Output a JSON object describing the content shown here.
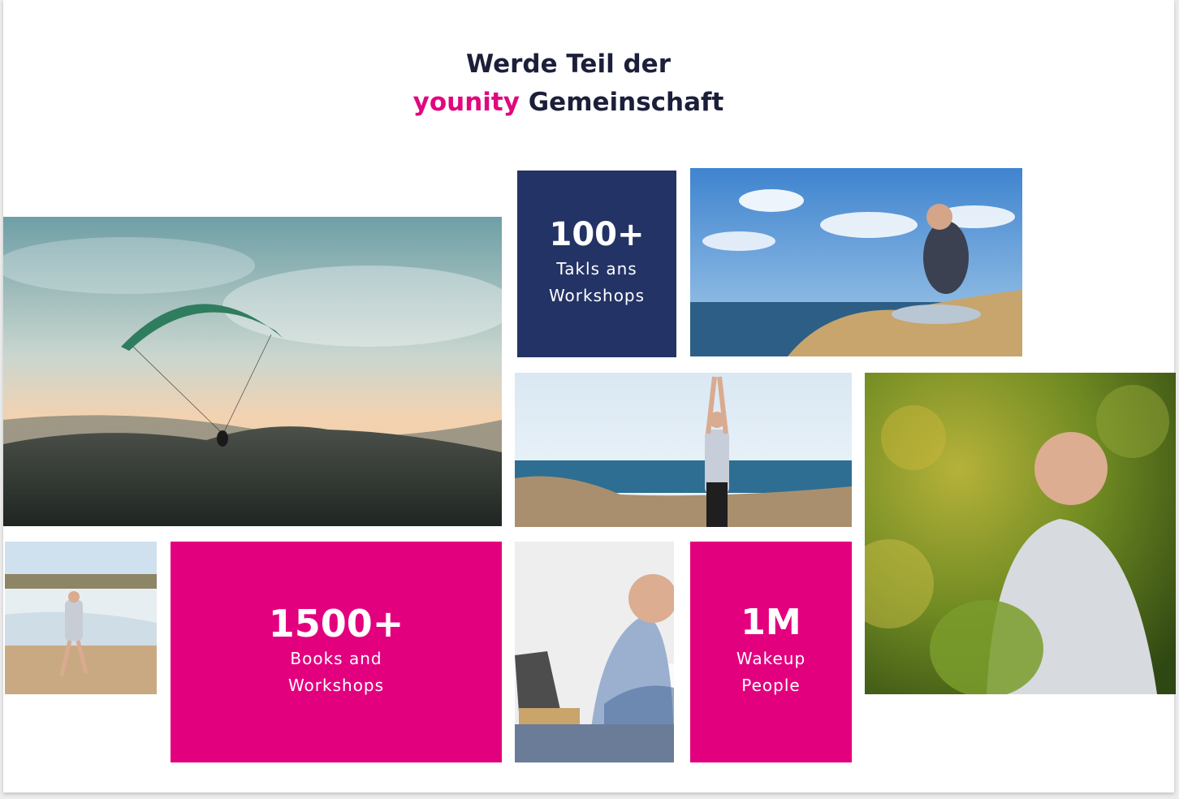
{
  "heading": {
    "line1": "Werde Teil der",
    "brand": "younity",
    "line2_rest": " Gemeinschaft"
  },
  "stats": [
    {
      "number": "100+",
      "label_line1": "Takls ans",
      "label_line2": "Workshops",
      "color": "#233365"
    },
    {
      "number": "1500+",
      "label_line1": "Books and",
      "label_line2": "Workshops",
      "color": "#e3007f"
    },
    {
      "number": "1M",
      "label_line1": "Wakeup",
      "label_line2": "People",
      "color": "#e3007f"
    }
  ],
  "photos": [
    {
      "name": "paraglider-photo"
    },
    {
      "name": "seated-seaside-photo"
    },
    {
      "name": "tree-pose-photo"
    },
    {
      "name": "portrait-greenery-photo"
    },
    {
      "name": "beach-run-photo"
    },
    {
      "name": "laptop-photo"
    }
  ],
  "colors": {
    "brand_pink": "#e0087e",
    "navy": "#233365",
    "heading_text": "#1c1f3a"
  }
}
